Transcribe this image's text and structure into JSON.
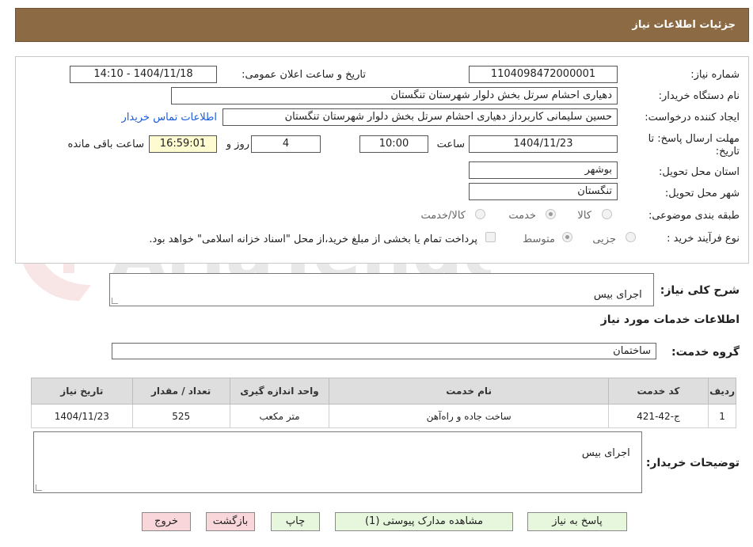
{
  "header": {
    "title": "جزئیات اطلاعات نیاز"
  },
  "form": {
    "need_number_label": "شماره نیاز:",
    "need_number": "1104098472000001",
    "announce_label": "تاریخ و ساعت اعلان عمومی:",
    "announce_value": "1404/11/18 - 14:10",
    "buyer_org_label": "نام دستگاه خریدار:",
    "buyer_org": "دهیاری احشام سرتل بخش دلوار شهرستان تنگستان",
    "creator_label": "ایجاد کننده درخواست:",
    "creator": "حسین سلیمانی کاربرداز دهیاری احشام سرتل بخش دلوار شهرستان تنگستان",
    "contact_link": "اطلاعات تماس خریدار",
    "deadline_label_1": "مهلت ارسال پاسخ: تا",
    "deadline_label_2": "تاریخ:",
    "deadline_date": "1404/11/23",
    "time_label": "ساعت",
    "deadline_time": "10:00",
    "days": "4",
    "days_label": "روز و",
    "remaining_time": "16:59:01",
    "remaining_label": "ساعت باقی مانده",
    "province_label": "استان محل تحویل:",
    "province": "بوشهر",
    "city_label": "شهر محل تحویل:",
    "city": "تنگستان",
    "category_label": "طبقه بندی موضوعی:",
    "category_options": [
      "کالا",
      "خدمت",
      "کالا/خدمت"
    ],
    "process_label": "نوع فرآیند خرید :",
    "process_options": [
      "جزیی",
      "متوسط"
    ],
    "payment_note": "پرداخت تمام یا بخشی از مبلغ خرید،از محل \"اسناد خزانه اسلامی\" خواهد بود."
  },
  "summary": {
    "label": "شرح کلی نیاز:",
    "value": "اجرای بیس"
  },
  "services": {
    "section_title": "اطلاعات خدمات مورد نیاز",
    "group_label": "گروه خدمت:",
    "group_value": "ساختمان",
    "columns": [
      "ردیف",
      "کد خدمت",
      "نام خدمت",
      "واحد اندازه گیری",
      "تعداد / مقدار",
      "تاریخ نیاز"
    ],
    "rows": [
      [
        "1",
        "ج-42-421",
        "ساخت جاده و راه‌آهن",
        "متر مکعب",
        "525",
        "1404/11/23"
      ]
    ]
  },
  "buyer_notes": {
    "label": "توضیحات خریدار:",
    "value": "اجرای بیس"
  },
  "buttons": {
    "reply": "پاسخ به نیاز",
    "attachments": "مشاهده مدارک پیوستی (1)",
    "print": "چاپ",
    "back": "بازگشت",
    "exit": "خروج"
  },
  "watermark": {
    "text": "AriaTender.neT"
  }
}
